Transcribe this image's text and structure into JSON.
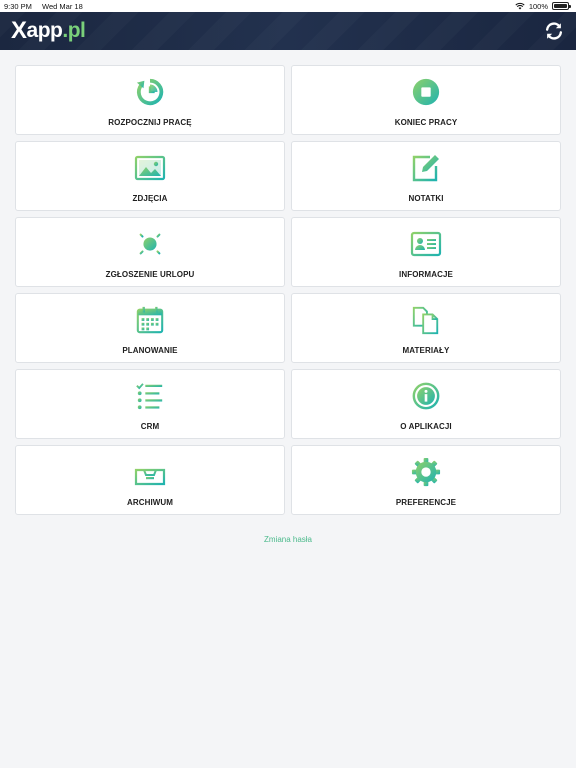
{
  "status_bar": {
    "time": "9:30 PM",
    "date": "Wed Mar 18",
    "battery": "100%"
  },
  "header": {
    "logo_x": "X",
    "logo_app": "app",
    "logo_tld": ".pl",
    "refresh_icon": "refresh-icon"
  },
  "colors": {
    "header_bg": "#1b2740",
    "accent_green": "#7ad17a",
    "accent_teal": "#2fb8a8",
    "link": "#4cba8c"
  },
  "tiles": [
    {
      "label": "ROZPOCZNIJ PRACĘ",
      "icon": "start-work-icon"
    },
    {
      "label": "KONIEC PRACY",
      "icon": "stop-icon"
    },
    {
      "label": "ZDJĘCIA",
      "icon": "photo-icon"
    },
    {
      "label": "NOTATKI",
      "icon": "edit-note-icon"
    },
    {
      "label": "ZGŁOSZENIE URLOPU",
      "icon": "sun-icon"
    },
    {
      "label": "INFORMACJE",
      "icon": "id-card-icon"
    },
    {
      "label": "PLANOWANIE",
      "icon": "calendar-icon"
    },
    {
      "label": "MATERIAŁY",
      "icon": "documents-icon"
    },
    {
      "label": "CRM",
      "icon": "checklist-icon"
    },
    {
      "label": "O APLIKACJI",
      "icon": "info-icon"
    },
    {
      "label": "ARCHIWUM",
      "icon": "archive-tray-icon"
    },
    {
      "label": "PREFERENCJE",
      "icon": "gear-icon"
    }
  ],
  "footer": {
    "change_password": "Zmiana hasła"
  }
}
